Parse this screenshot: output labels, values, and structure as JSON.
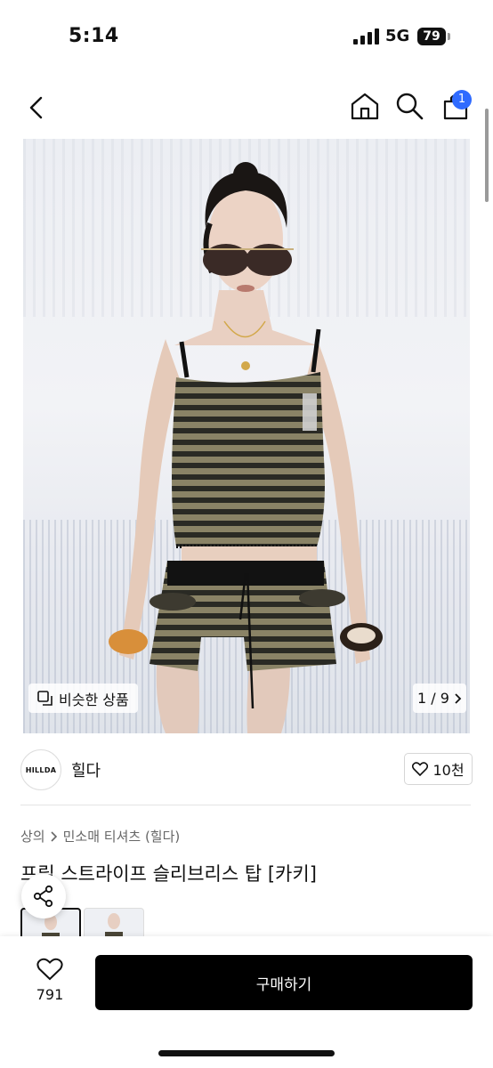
{
  "status_bar": {
    "time": "5:14",
    "network": "5G",
    "battery": "79"
  },
  "nav": {
    "back_icon": "chevron-left-icon",
    "home_icon": "home-icon",
    "search_icon": "search-icon",
    "cart_icon": "shopping-bag-icon",
    "cart_badge": "1"
  },
  "gallery": {
    "similar_label": "비슷한 상품",
    "counter": "1 / 9"
  },
  "seller": {
    "logo_text": "HILLDA",
    "name": "힐다",
    "likes": "10천"
  },
  "breadcrumb": {
    "category": "상의",
    "subcategory": "민소매 티셔츠 (힐다)"
  },
  "product": {
    "title": "프릴 스트라이프 슬리브리스 탑 [카키]"
  },
  "actions": {
    "wish_count": "791",
    "buy_label": "구매하기"
  },
  "colors": {
    "accent": "#2f6bff",
    "buy_button": "#000000"
  }
}
